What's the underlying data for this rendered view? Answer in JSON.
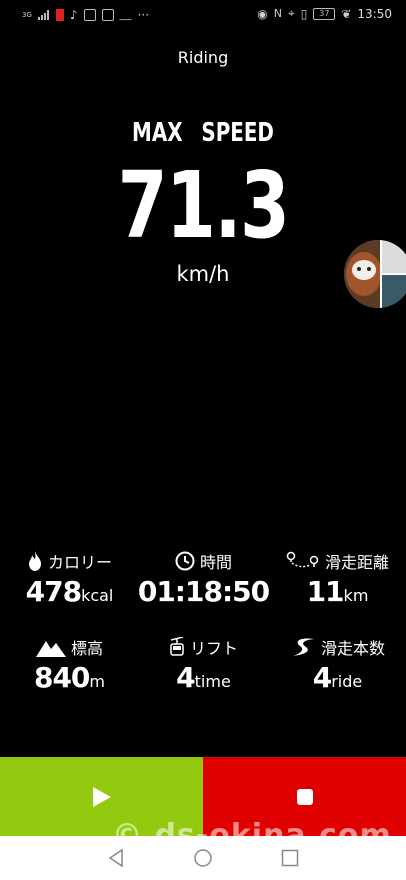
{
  "status_bar": {
    "signal_label": "3G",
    "time": "13:50",
    "battery": "37"
  },
  "screen": {
    "title": "Riding",
    "metric_label": "MAX SPEED",
    "metric_value": "71.3",
    "metric_unit": "km/h"
  },
  "stats": [
    {
      "icon": "flame-icon",
      "label": "カロリー",
      "value": "478",
      "unit": "kcal"
    },
    {
      "icon": "clock-icon",
      "label": "時間",
      "value": "01:18:50",
      "unit": ""
    },
    {
      "icon": "route-icon",
      "label": "滑走距離",
      "value": "11",
      "unit": "km"
    },
    {
      "icon": "mountain-icon",
      "label": "標高",
      "value": "840",
      "unit": "m"
    },
    {
      "icon": "gondola-icon",
      "label": "リフト",
      "value": "4",
      "unit": "time"
    },
    {
      "icon": "s-curve-icon",
      "label": "滑走本数",
      "value": "4",
      "unit": "ride"
    }
  ],
  "watermark": "© ds-okina.com",
  "colors": {
    "play_button": "#93c90e",
    "stop_button": "#e00000",
    "background": "#000000"
  }
}
